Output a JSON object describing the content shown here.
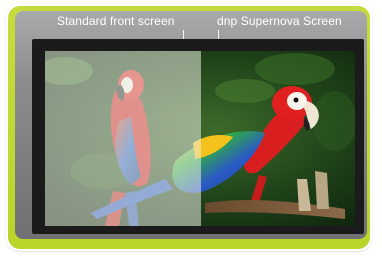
{
  "labels": {
    "standard": "Standard front screen",
    "supernova": "dnp Supernova Screen"
  },
  "colors": {
    "frame": "#c0d834",
    "bezel": "#1b1b1c",
    "parrot_red": "#d81e1e",
    "parrot_yellow": "#f4c21a",
    "parrot_blue": "#2a5bc4",
    "foliage": "#1f4a1a"
  }
}
